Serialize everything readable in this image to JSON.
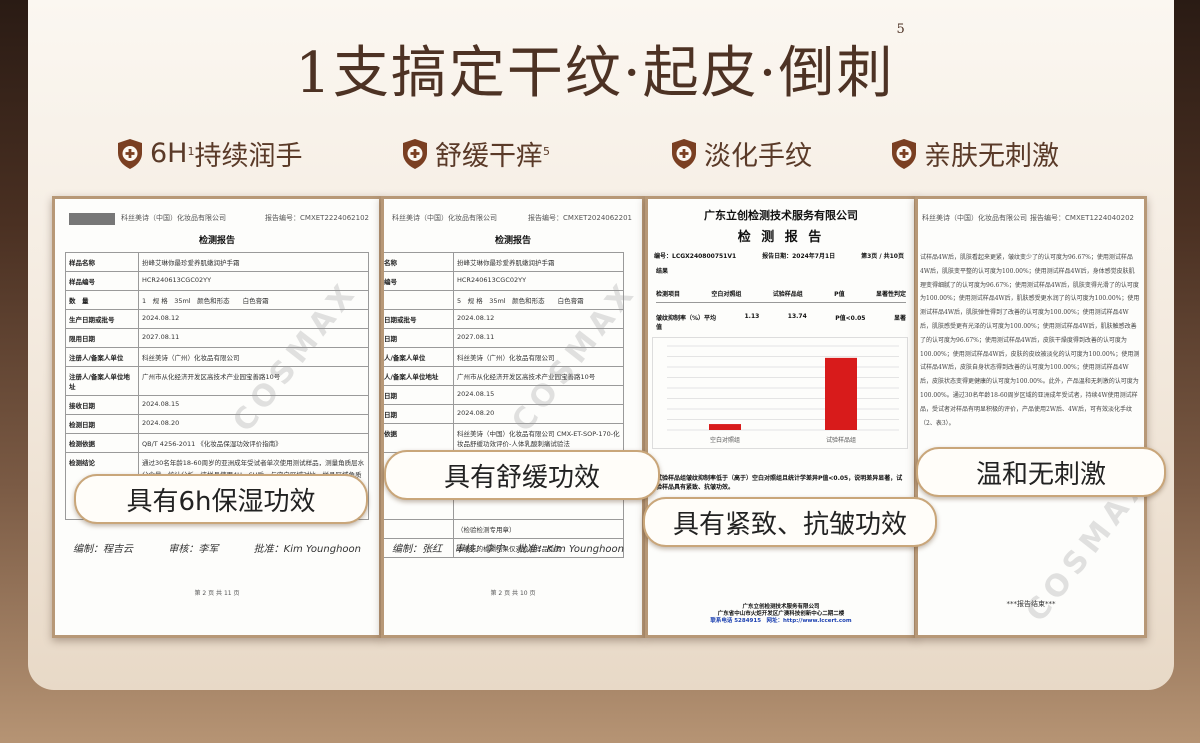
{
  "title": {
    "text": "1支搞定干纹·起皮·倒刺",
    "sup": "5"
  },
  "features": [
    {
      "icon": "shield-plus-icon",
      "text": "6H",
      "sup": "1",
      "text2": "持续润手"
    },
    {
      "icon": "shield-plus-icon",
      "text": "舒缓干痒",
      "sup": "5",
      "text2": ""
    },
    {
      "icon": "shield-plus-icon",
      "text": "淡化手纹",
      "sup": "",
      "text2": ""
    },
    {
      "icon": "shield-plus-icon",
      "text": "亲肤无刺激",
      "sup": "",
      "text2": ""
    }
  ],
  "doc1": {
    "header_left": "科丝美诗（中国）化妆品有限公司",
    "header_right": "报告编号：CMXET2224062102",
    "title": "检测报告",
    "rows": [
      {
        "k": "样品名称",
        "v": "扮峰艾琳你最珍爱养肌嫩润护手霜"
      },
      {
        "k": "样品编号",
        "v": "HCR240613CGC02YY"
      },
      {
        "k": "数　量",
        "v": "1　规 格　35ml　颜色和形态　　白色膏霜"
      },
      {
        "k": "生产日期或批号",
        "v": "2024.08.12"
      },
      {
        "k": "限用日期",
        "v": "2027.08.11"
      },
      {
        "k": "注册人/备案人单位",
        "v": "科丝美诗（广州）化妆品有限公司"
      },
      {
        "k": "注册人/备案人单位地址",
        "v": "广州市从化经济开发区高技术产业园宝善路10号"
      },
      {
        "k": "接收日期",
        "v": "2024.08.15"
      },
      {
        "k": "检测日期",
        "v": "2024.08.20"
      },
      {
        "k": "检测依据",
        "v": "QB/T 4256-2011 《化妆品保湿功效评价指南》"
      },
      {
        "k": "检测结论",
        "v": "通过30名年龄18-60周岁的亚洲成年受试者单次使用测试样品，测量角质层水分含量，统计分析。该样品使用4H、6H后，与空白区域对比，样品区域角质层水分含量显著性差异（P<0.05），该受试样品具有6h保湿功效。"
      }
    ],
    "signatures": [
      "编制：程吉云",
      "审核：李军",
      "批准：Kim Younghoon"
    ],
    "page": "第 2 页 共 11 页",
    "watermark": "COSMAX"
  },
  "doc2": {
    "header_left": "科丝美诗（中国）化妆品有限公司",
    "header_right": "报告编号：CMXET2024062201",
    "title": "检测报告",
    "rows": [
      {
        "k": "名称",
        "v": "扮峰艾琳你最珍爱养肌嫩润护手霜"
      },
      {
        "k": "编号",
        "v": "HCR240613CGC02YY"
      },
      {
        "k": "",
        "v": "5　规 格　35ml　颜色和形态　　白色膏霜"
      },
      {
        "k": "日期或批号",
        "v": "2024.08.12"
      },
      {
        "k": "日期",
        "v": "2027.08.11"
      },
      {
        "k": "人/备案人单位",
        "v": "科丝美诗（广州）化妆品有限公司"
      },
      {
        "k": "人/备案人单位地址",
        "v": "广州市从化经济开发区高技术产业园宝善路10号"
      },
      {
        "k": "日期",
        "v": "2024.08.15"
      },
      {
        "k": "日期",
        "v": "2024.08.20"
      },
      {
        "k": "依据",
        "v": "科丝美诗（中国）化妆品有限公司 CMX-ET-SOP-170-化妆品舒缓功效评价-人体乳酸刺痛试验法"
      },
      {
        "k": "",
        "v": "通过乳酸刺痛测试受试者入组测试，以克服为依据判定该样品舒缓刺痛状态，统计受试者对产品使用后刺痛程度的评分与对照区域比较，具有舒缓功效。"
      },
      {
        "k": "",
        "v": "（检验检测专用章）"
      },
      {
        "k": "",
        "v": "本报告的检测结果仅对检测样品负责"
      }
    ],
    "signatures": [
      "编制：张红",
      "审核：李宁",
      "批准：Kim Younghoon"
    ],
    "page": "第 2 页 共 10 页",
    "watermark": "COSMAX"
  },
  "doc3": {
    "org": "广东立创检测技术服务有限公司",
    "title": "检 测 报 告",
    "meta_left": "编号：LCGX240800751V1",
    "meta_mid": "报告日期：2024年7月1日",
    "meta_right": "第3页 / 共10页",
    "section": "结果",
    "table_head": [
      "检测项目",
      "空白对照组",
      "试验样品组",
      "P值",
      "显著性判定"
    ],
    "table_row": [
      "皱纹抑制率（%）平均值",
      "1.13",
      "13.74",
      "P值<0.05",
      "显著"
    ],
    "note": "试验样品组皱纹抑制率低于（高于）空白对照组且统计学差异P值<0.05，说明差异显著，试验样品具有紧致、抗皱功效。",
    "footer": [
      "广东立创检测技术服务有限公司",
      "广东省中山市火炬开发区广澳科技创新中心二期二楼",
      "联系电话 5284915　网址：http://www.lccert.com"
    ]
  },
  "chart_data": {
    "type": "bar",
    "categories": [
      "空白对照组",
      "试验样品组"
    ],
    "values": [
      1.13,
      13.74
    ],
    "title": "",
    "xlabel": "",
    "ylabel": "",
    "ylim": [
      0,
      16
    ],
    "bar_color": "#d81b1b"
  },
  "doc4": {
    "header_left": "科丝美诗（中国）化妆品有限公司",
    "header_right": "报告编号：CMXET1224040202",
    "text": "试样品4W后，肌肤看起来更紧，皱纹变少了的认可度为96.67%；使用测试样品4W后，肌肤变平整的认可度为100.00%；使用测试样品4W后，身体感觉皮肤肌理变得细腻了的认可度为96.67%；使用测试样品4W后，肌肤变得光滑了的认可度为100.00%；使用测试样品4W后，肌肤感受更水润了的认可度为100.00%；使用测试样品4W后，肌肤弹性得到了改善的认可度为100.00%；使用测试样品4W后，肌肤感受更有光泽的认可度为100.00%；使用测试样品4W后，肌肤触感改善了的认可度为96.67%；使用测试样品4W后，皮肤干燥度得到改善的认可度为100.00%；使用测试样品4W后，皮肤的皮纹被淡化的认可度为100.00%；使用测试样品4W后，皮肤自身状态得到改善的认可度为100.00%；使用测试样品4W后，皮肤状态变得更健康的认可度为100.00%。此外，产品温和无刺激的认可度为100.00%。通过30名年龄18-60周岁区域的亚洲成年受试者，持续4W使用测试样品，受试者对样品有明显积极的评价，产品使用2W后、4W后，可有效淡化手纹（2、表3）。",
    "end": "***报告结束***",
    "watermark": "COSMAX"
  },
  "bubbles": [
    "具有6h保湿功效",
    "具有舒缓功效",
    "具有紧致、抗皱功效",
    "温和无刺激"
  ]
}
